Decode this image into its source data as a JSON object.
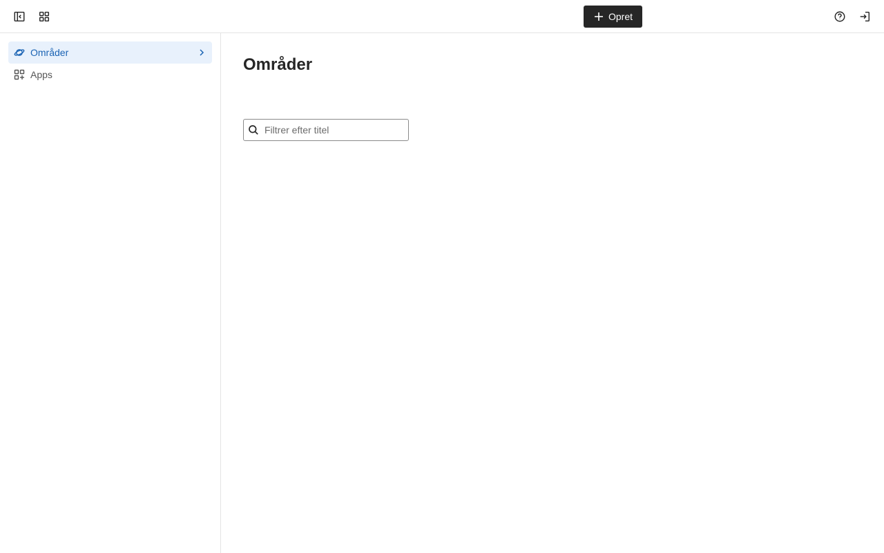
{
  "header": {
    "sidebar_toggle_icon": "sidebar-collapse-icon",
    "apps_grid_icon": "grid-icon",
    "create_button": {
      "label": "Opret",
      "icon": "plus-icon",
      "bg_color": "#262626"
    },
    "help_icon": "help-circle-icon",
    "login_icon": "login-icon"
  },
  "sidebar": {
    "items": [
      {
        "label": "Områder",
        "icon": "planet-icon",
        "active": true,
        "color": "#1a63b3"
      },
      {
        "label": "Apps",
        "icon": "apps-add-icon",
        "active": false
      }
    ]
  },
  "main": {
    "title": "Områder",
    "filter": {
      "placeholder": "Filtrer efter titel",
      "value": ""
    }
  }
}
